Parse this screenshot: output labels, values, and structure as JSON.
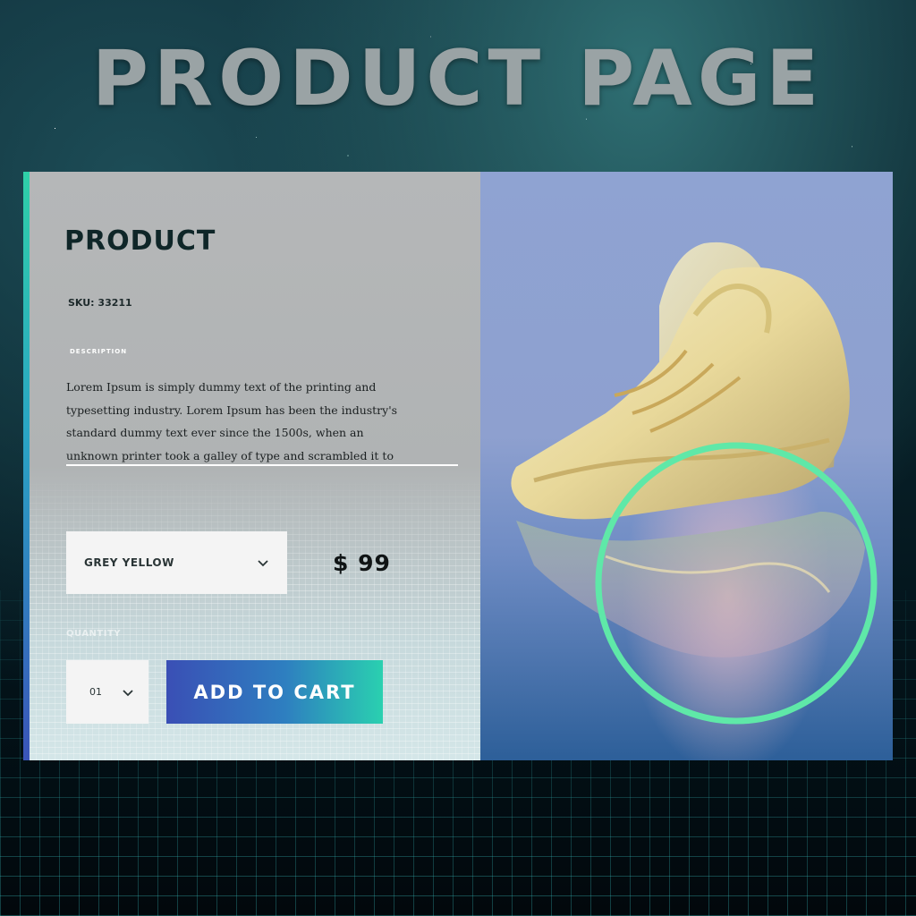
{
  "page": {
    "headline": "PRODUCT PAGE"
  },
  "product": {
    "title": "PRODUCT",
    "sku": "SKU: 33211",
    "description_label": "DESCRIPTION",
    "description": "Lorem Ipsum is simply dummy text of the printing and typesetting industry. Lorem Ipsum has been the industry's standard dummy text ever since the 1500s, when an unknown printer took a galley of type and scrambled it to",
    "color_option": "GREY YELLOW",
    "price": "$ 99",
    "quantity_label": "QUANTITY",
    "quantity_value": "01",
    "add_to_cart_label": "ADD TO CART",
    "image_icon": "sneaker-image"
  },
  "colors": {
    "accent_green": "#5fe8a8",
    "button_start": "#3a4fb5",
    "button_end": "#2ad0b0"
  }
}
